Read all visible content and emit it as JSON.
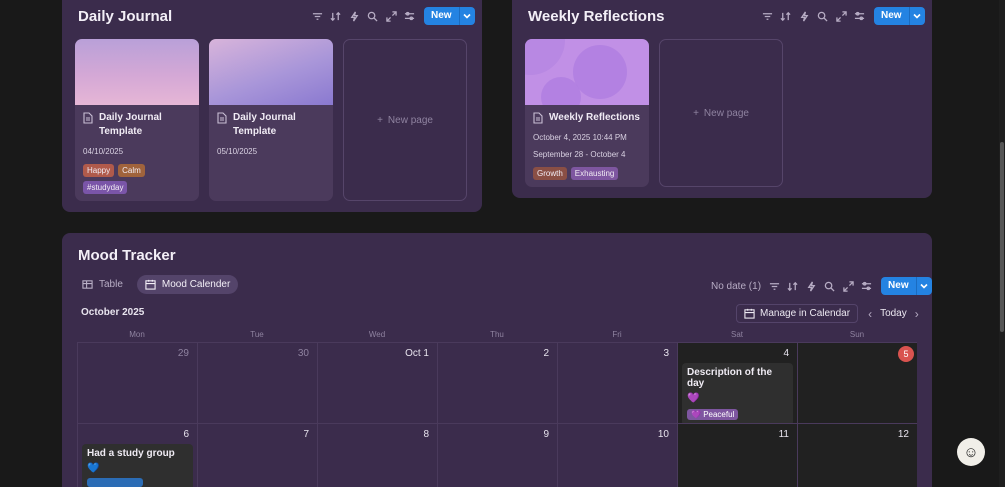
{
  "daily_journal": {
    "title": "Daily Journal",
    "new_label": "New",
    "cards": [
      {
        "title_line1": "Daily Journal",
        "title_line2": "Template",
        "date": "04/10/2025",
        "tags": [
          {
            "label": "Happy",
            "color": "#b05a4b"
          },
          {
            "label": "Calm",
            "color": "#a0633c"
          },
          {
            "label": "#studyday",
            "color": "#7a55a8"
          }
        ]
      },
      {
        "title_line1": "Daily Journal",
        "title_line2": "Template",
        "date": "05/10/2025",
        "tags": []
      }
    ],
    "new_page_label": "New page"
  },
  "weekly_reflections": {
    "title": "Weekly Reflections",
    "new_label": "New",
    "card": {
      "title": "Weekly Reflections",
      "created": "October 4, 2025 10:44 PM",
      "range": "September 28 - October 4",
      "tags": [
        {
          "label": "Growth",
          "color": "#8a4f45"
        },
        {
          "label": "Exhausting",
          "color": "#7e56a0"
        }
      ]
    },
    "new_page_label": "New page"
  },
  "mood_tracker": {
    "title": "Mood Tracker",
    "tabs": [
      {
        "label": "Table"
      },
      {
        "label": "Mood Calender"
      }
    ],
    "no_date": "No date (1)",
    "new_label": "New",
    "month": "October 2025",
    "manage_label": "Manage in Calendar",
    "today_label": "Today",
    "weekdays": [
      "Mon",
      "Tue",
      "Wed",
      "Thu",
      "Fri",
      "Sat",
      "Sun"
    ],
    "week1": [
      "29",
      "30",
      "Oct 1",
      "2",
      "3",
      "4",
      "5"
    ],
    "week2": [
      "6",
      "7",
      "8",
      "9",
      "10",
      "11",
      "12"
    ],
    "event_sat": {
      "title": "Description of the day",
      "heart": "💜",
      "tag": "Peaceful",
      "tag_color": "#7e56a0"
    },
    "event_mon": {
      "title": "Had a study group",
      "heart": "💙",
      "tag_color": "#2b6cb5"
    }
  },
  "help": {
    "icon": "help-avatar-icon"
  }
}
